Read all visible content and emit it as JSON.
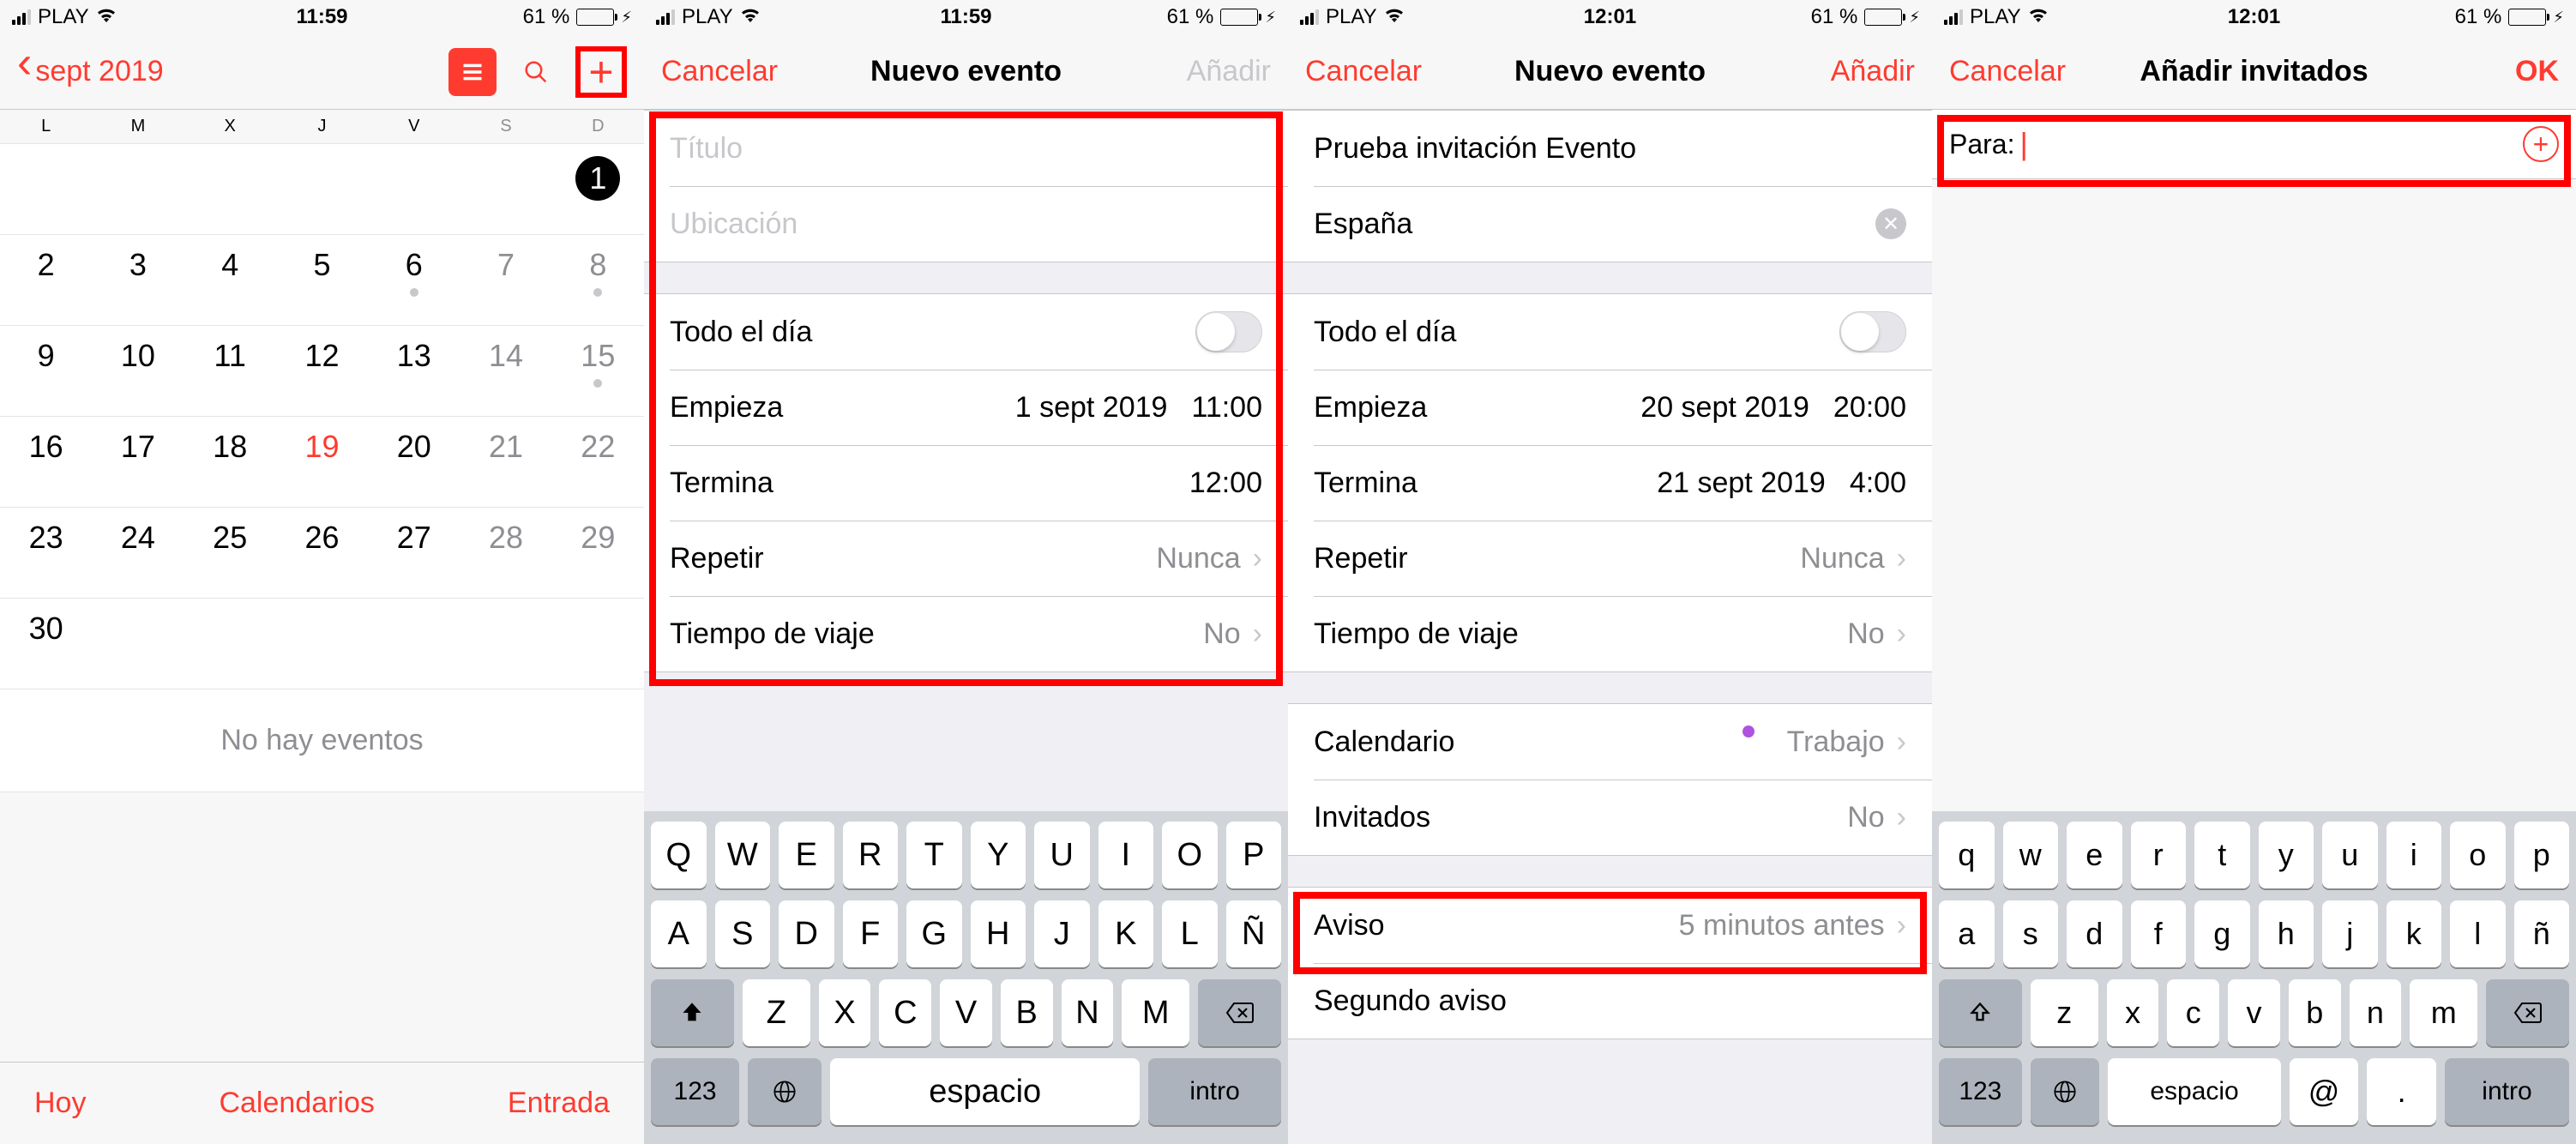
{
  "status": {
    "carrier": "PLAY",
    "time1": "11:59",
    "time2": "12:01",
    "battery": "61 %"
  },
  "screen1": {
    "back": "sept 2019",
    "weekdays": [
      "L",
      "M",
      "X",
      "J",
      "V",
      "S",
      "D"
    ],
    "no_events": "No hay eventos",
    "tabs": {
      "today": "Hoy",
      "calendars": "Calendarios",
      "inbox": "Entrada"
    },
    "days": [
      [
        null,
        null,
        null,
        null,
        null,
        null,
        {
          "n": "1",
          "sel": true
        }
      ],
      [
        {
          "n": "2"
        },
        {
          "n": "3"
        },
        {
          "n": "4"
        },
        {
          "n": "5"
        },
        {
          "n": "6",
          "dot": true
        },
        {
          "n": "7",
          "wknd": true
        },
        {
          "n": "8",
          "wknd": true,
          "dot": true
        }
      ],
      [
        {
          "n": "9"
        },
        {
          "n": "10"
        },
        {
          "n": "11"
        },
        {
          "n": "12"
        },
        {
          "n": "13"
        },
        {
          "n": "14",
          "wknd": true
        },
        {
          "n": "15",
          "wknd": true,
          "dot": true
        }
      ],
      [
        {
          "n": "16"
        },
        {
          "n": "17"
        },
        {
          "n": "18"
        },
        {
          "n": "19",
          "today": true
        },
        {
          "n": "20"
        },
        {
          "n": "21",
          "wknd": true
        },
        {
          "n": "22",
          "wknd": true
        }
      ],
      [
        {
          "n": "23"
        },
        {
          "n": "24"
        },
        {
          "n": "25"
        },
        {
          "n": "26"
        },
        {
          "n": "27"
        },
        {
          "n": "28",
          "wknd": true
        },
        {
          "n": "29",
          "wknd": true
        }
      ],
      [
        {
          "n": "30"
        },
        null,
        null,
        null,
        null,
        null,
        null
      ]
    ]
  },
  "screen2": {
    "cancel": "Cancelar",
    "title": "Nuevo evento",
    "add": "Añadir",
    "title_ph": "Título",
    "loc_ph": "Ubicación",
    "allday": "Todo el día",
    "starts": "Empieza",
    "starts_date": "1 sept 2019",
    "starts_time": "11:00",
    "ends": "Termina",
    "ends_time": "12:00",
    "repeat": "Repetir",
    "repeat_val": "Nunca",
    "travel": "Tiempo de viaje",
    "travel_val": "No",
    "keys_r1": [
      "Q",
      "W",
      "E",
      "R",
      "T",
      "Y",
      "U",
      "I",
      "O",
      "P"
    ],
    "keys_r2": [
      "A",
      "S",
      "D",
      "F",
      "G",
      "H",
      "J",
      "K",
      "L",
      "Ñ"
    ],
    "keys_r3": [
      "Z",
      "X",
      "C",
      "V",
      "B",
      "N",
      "M"
    ],
    "num": "123",
    "space": "espacio",
    "enter": "intro"
  },
  "screen3": {
    "cancel": "Cancelar",
    "title": "Nuevo evento",
    "add": "Añadir",
    "event_title": "Prueba invitación Evento",
    "event_loc": "España",
    "allday": "Todo el día",
    "starts": "Empieza",
    "starts_date": "20 sept 2019",
    "starts_time": "20:00",
    "ends": "Termina",
    "ends_date": "21 sept 2019",
    "ends_time": "4:00",
    "repeat": "Repetir",
    "repeat_val": "Nunca",
    "travel": "Tiempo de viaje",
    "travel_val": "No",
    "calendar": "Calendario",
    "calendar_val": "Trabajo",
    "invitees": "Invitados",
    "invitees_val": "No",
    "alert": "Aviso",
    "alert_val": "5 minutos antes",
    "alert2": "Segundo aviso"
  },
  "screen4": {
    "cancel": "Cancelar",
    "title": "Añadir invitados",
    "ok": "OK",
    "to": "Para:",
    "keys_r1": [
      "q",
      "w",
      "e",
      "r",
      "t",
      "y",
      "u",
      "i",
      "o",
      "p"
    ],
    "keys_r2": [
      "a",
      "s",
      "d",
      "f",
      "g",
      "h",
      "j",
      "k",
      "l",
      "ñ"
    ],
    "keys_r3": [
      "z",
      "x",
      "c",
      "v",
      "b",
      "n",
      "m"
    ],
    "num": "123",
    "space": "espacio",
    "at": "@",
    "dot": ".",
    "enter": "intro"
  }
}
